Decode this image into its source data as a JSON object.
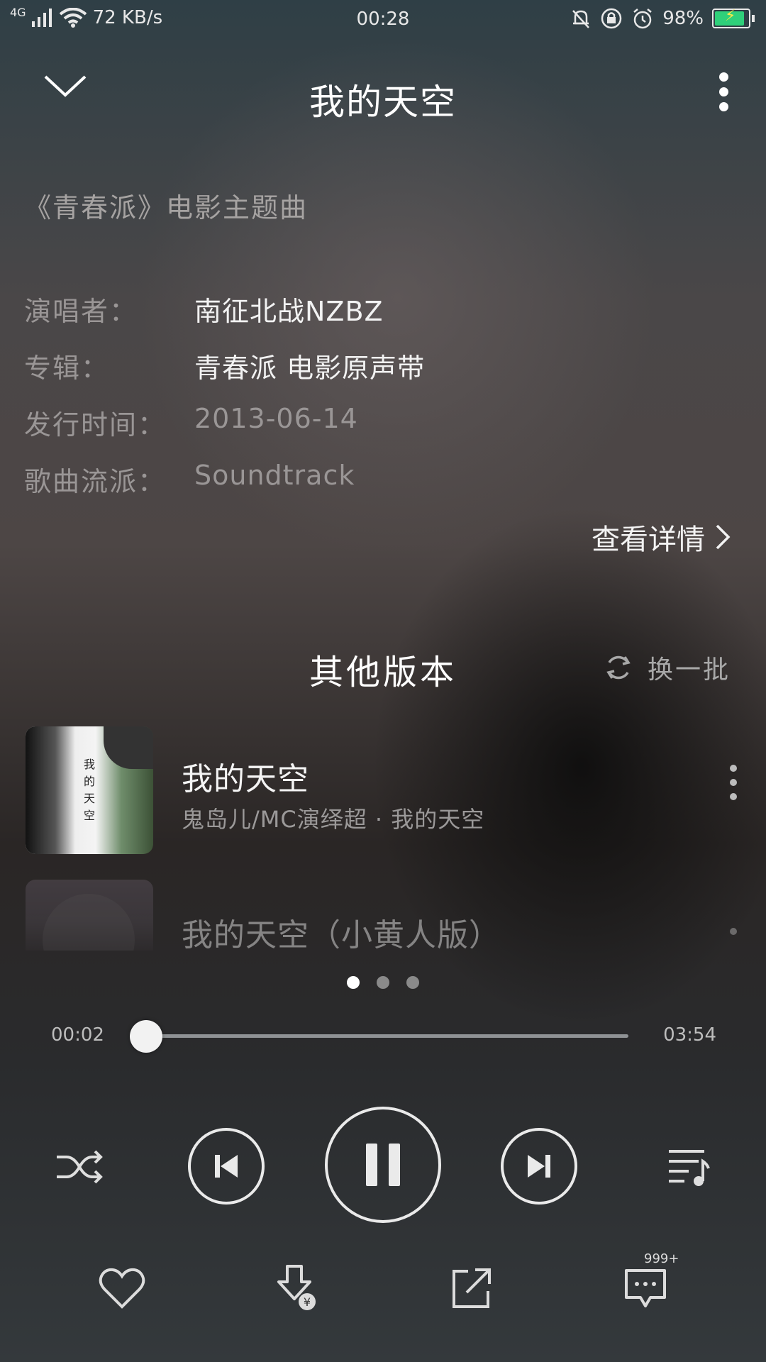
{
  "status_bar": {
    "network": "4G",
    "speed": "72 KB/s",
    "time": "00:28",
    "battery": "98%",
    "battery_level": 0.98,
    "icons": [
      "signal-icon",
      "wifi-icon",
      "mute-bell-icon",
      "rotation-lock-icon",
      "alarm-icon",
      "battery-icon"
    ]
  },
  "header": {
    "title": "我的天空"
  },
  "subtitle": "《青春派》电影主题曲",
  "info": [
    {
      "label": "演唱者：",
      "value": "南征北战NZBZ"
    },
    {
      "label": "专辑：",
      "value": "青春派 电影原声带"
    },
    {
      "label": "发行时间：",
      "value": "2013-06-14"
    },
    {
      "label": "歌曲流派：",
      "value": "Soundtrack"
    }
  ],
  "detail_link": "查看详情",
  "versions_section": {
    "title": "其他版本",
    "refresh_label": "换一批",
    "items": [
      {
        "title": "我的天空",
        "subtitle": "鬼岛儿/MC演绎超 · 我的天空",
        "cover_text": "我的天空"
      },
      {
        "title": "我的天空（小黄人版）",
        "subtitle": ""
      }
    ]
  },
  "pager": {
    "count": 3,
    "active": 0
  },
  "player": {
    "current_time": "00:02",
    "total_time": "03:54",
    "progress": 0.009
  },
  "controls": {
    "icons": [
      "shuffle-icon",
      "previous-icon",
      "pause-icon",
      "next-icon",
      "playlist-icon"
    ]
  },
  "actions": {
    "comment_count": "999+",
    "icons": [
      "heart-icon",
      "download-icon",
      "share-icon",
      "comment-icon"
    ]
  },
  "colors": {
    "battery_fill": "#2fd07a",
    "accent": "#ffffff"
  }
}
